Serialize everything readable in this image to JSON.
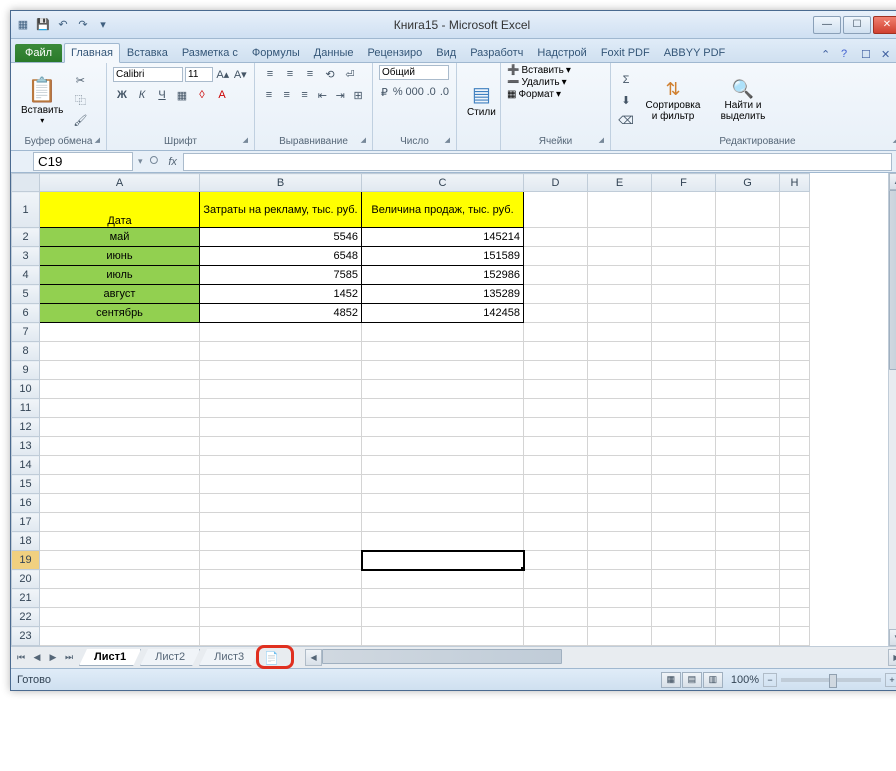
{
  "window": {
    "title": "Книга15 - Microsoft Excel"
  },
  "tabs": {
    "file": "Файл",
    "items": [
      "Главная",
      "Вставка",
      "Разметка с",
      "Формулы",
      "Данные",
      "Рецензиро",
      "Вид",
      "Разработч",
      "Надстрой",
      "Foxit PDF",
      "ABBYY PDF"
    ],
    "active": 0
  },
  "ribbon": {
    "clipboard": {
      "paste": "Вставить",
      "label": "Буфер обмена"
    },
    "font": {
      "name": "Calibri",
      "size": "11",
      "label": "Шрифт"
    },
    "align": {
      "label": "Выравнивание"
    },
    "number": {
      "format": "Общий",
      "label": "Число"
    },
    "styles": {
      "btn": "Стили"
    },
    "cells": {
      "insert": "Вставить",
      "delete": "Удалить",
      "format": "Формат",
      "label": "Ячейки"
    },
    "editing": {
      "sort": "Сортировка и фильтр",
      "find": "Найти и выделить",
      "label": "Редактирование"
    }
  },
  "namebox": "C19",
  "formula": "",
  "columns": [
    "A",
    "B",
    "C",
    "D",
    "E",
    "F",
    "G",
    "H"
  ],
  "headers": {
    "a": "Дата",
    "b": "Затраты на рекламу, тыс. руб.",
    "c": "Величина продаж, тыс. руб."
  },
  "rows": [
    {
      "a": "май",
      "b": "5546",
      "c": "145214"
    },
    {
      "a": "июнь",
      "b": "6548",
      "c": "151589"
    },
    {
      "a": "июль",
      "b": "7585",
      "c": "152986"
    },
    {
      "a": "август",
      "b": "1452",
      "c": "135289"
    },
    {
      "a": "сентябрь",
      "b": "4852",
      "c": "142458"
    }
  ],
  "sheets": {
    "items": [
      "Лист1",
      "Лист2",
      "Лист3"
    ],
    "active": 0
  },
  "status": {
    "ready": "Готово",
    "zoom": "100%"
  }
}
